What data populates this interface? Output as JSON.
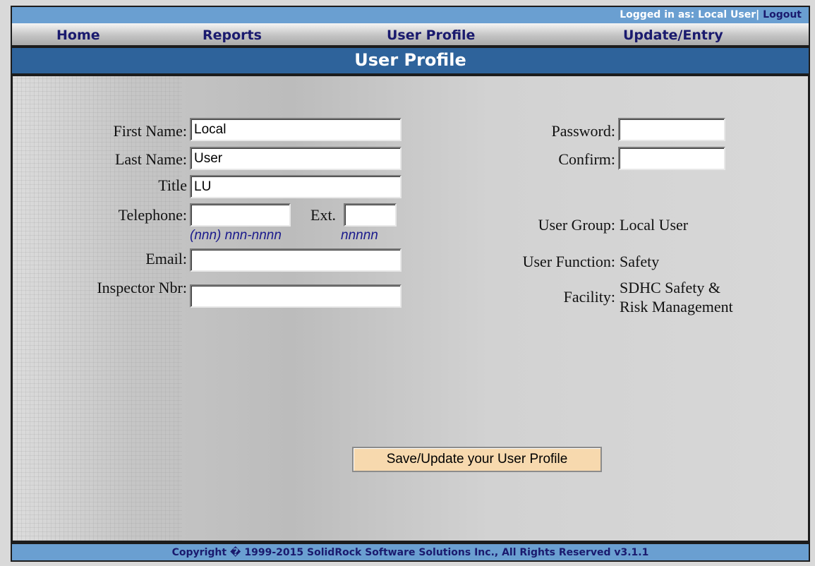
{
  "header": {
    "logged_in_text": "Logged in as: Local User|",
    "logout_label": "Logout"
  },
  "nav": {
    "items": [
      {
        "label": "Home"
      },
      {
        "label": "Reports"
      },
      {
        "label": "User Profile"
      },
      {
        "label": "Update/Entry"
      }
    ]
  },
  "page": {
    "title": "User Profile"
  },
  "form": {
    "first_name": {
      "label": "First Name:",
      "value": "Local"
    },
    "last_name": {
      "label": "Last Name:",
      "value": "User"
    },
    "title": {
      "label": "Title",
      "value": "LU"
    },
    "telephone": {
      "label": "Telephone:",
      "value": "",
      "hint": "(nnn) nnn-nnnn"
    },
    "ext": {
      "label": "Ext.",
      "value": "",
      "hint": "nnnnn"
    },
    "email": {
      "label": "Email:",
      "value": ""
    },
    "inspector_nbr": {
      "label": "Inspector Nbr:",
      "value": ""
    },
    "password": {
      "label": "Password:",
      "value": ""
    },
    "confirm": {
      "label": "Confirm:",
      "value": ""
    },
    "user_group": {
      "label": "User Group:",
      "value": "Local User"
    },
    "user_function": {
      "label": "User Function:",
      "value": "Safety"
    },
    "facility": {
      "label": "Facility:",
      "value_line1": "SDHC Safety &",
      "value_line2": "Risk Management"
    },
    "save_label": "Save/Update your User Profile"
  },
  "footer": {
    "copyright": "Copyright � 1999-2015 SolidRock Software Solutions Inc., All Rights Reserved v3.1.1"
  },
  "colors": {
    "header_blue": "#6a9fd1",
    "title_blue": "#2e639b",
    "nav_text": "#1a1a6e",
    "save_button": "#f7d9ae",
    "hint_text": "#1a1a8c"
  }
}
